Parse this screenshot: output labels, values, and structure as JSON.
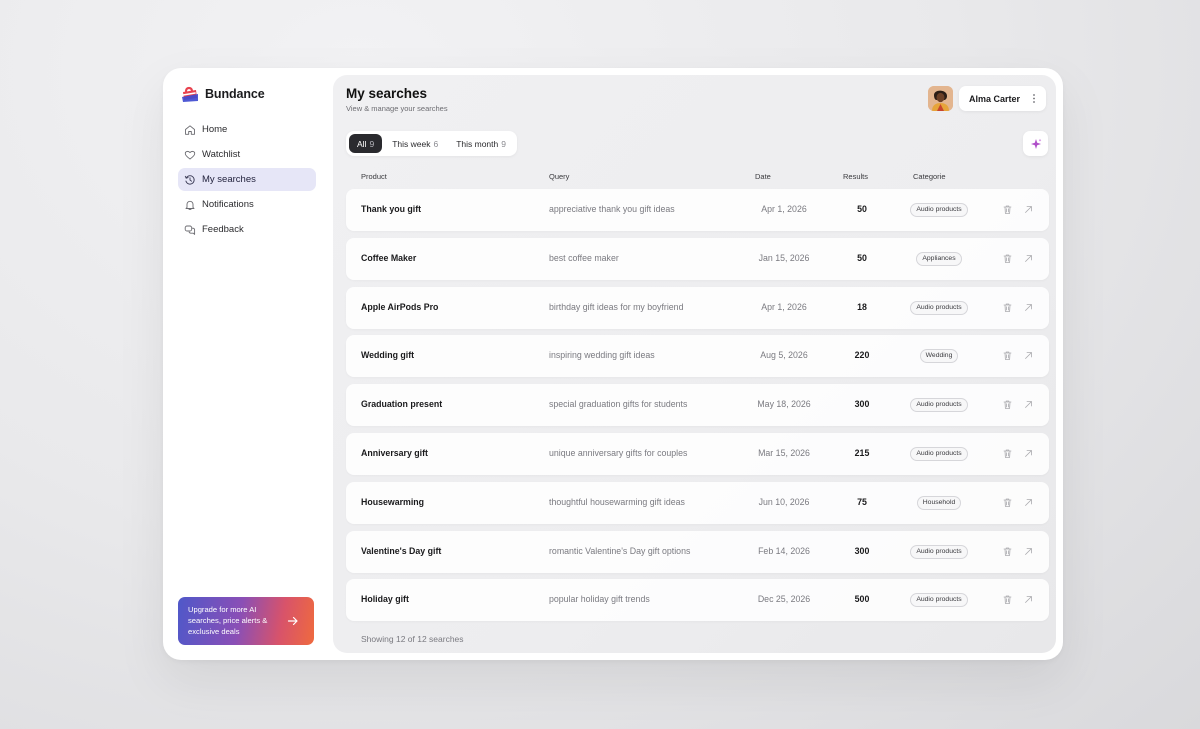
{
  "brand": {
    "name": "Bundance"
  },
  "sidebar": {
    "items": [
      {
        "label": "Home",
        "icon": "home-icon",
        "active": false
      },
      {
        "label": "Watchlist",
        "icon": "heart-icon",
        "active": false
      },
      {
        "label": "My searches",
        "icon": "history-icon",
        "active": true
      },
      {
        "label": "Notifications",
        "icon": "bell-icon",
        "active": false
      },
      {
        "label": "Feedback",
        "icon": "chat-icon",
        "active": false
      }
    ],
    "upgrade": {
      "text": "Upgrade for more AI searches, price alerts & exclusive deals",
      "icon": "arrow-right-icon"
    }
  },
  "header": {
    "title": "My searches",
    "subtitle": "View & manage your searches",
    "user": {
      "name": "Alma Carter"
    }
  },
  "tabs": [
    {
      "label": "All",
      "count": "9",
      "active": true
    },
    {
      "label": "This week",
      "count": "6",
      "active": false
    },
    {
      "label": "This month",
      "count": "9",
      "active": false
    }
  ],
  "table": {
    "columns": {
      "product": "Product",
      "query": "Query",
      "date": "Date",
      "results": "Results",
      "category": "Categorie"
    },
    "rows": [
      {
        "product": "Thank you gift",
        "query": "appreciative thank you gift ideas",
        "date": "Apr 1, 2026",
        "results": "50",
        "category": "Audio products"
      },
      {
        "product": "Coffee Maker",
        "query": "best coffee maker",
        "date": "Jan 15, 2026",
        "results": "50",
        "category": "Appliances"
      },
      {
        "product": "Apple AirPods Pro",
        "query": "birthday gift ideas for my boyfriend",
        "date": "Apr 1, 2026",
        "results": "18",
        "category": "Audio products"
      },
      {
        "product": "Wedding gift",
        "query": "inspiring wedding gift ideas",
        "date": "Aug 5, 2026",
        "results": "220",
        "category": "Wedding"
      },
      {
        "product": "Graduation present",
        "query": "special graduation gifts for students",
        "date": "May 18, 2026",
        "results": "300",
        "category": "Audio products"
      },
      {
        "product": "Anniversary gift",
        "query": "unique anniversary gifts for couples",
        "date": "Mar 15, 2026",
        "results": "215",
        "category": "Audio products"
      },
      {
        "product": "Housewarming",
        "query": "thoughtful housewarming gift ideas",
        "date": "Jun 10, 2026",
        "results": "75",
        "category": "Household"
      },
      {
        "product": "Valentine's Day gift",
        "query": "romantic Valentine's Day gift options",
        "date": "Feb 14, 2026",
        "results": "300",
        "category": "Audio products"
      },
      {
        "product": "Holiday gift",
        "query": "popular holiday gift trends",
        "date": "Dec 25, 2026",
        "results": "500",
        "category": "Audio products"
      }
    ],
    "footer": "Showing 12 of 12 searches"
  },
  "colors": {
    "accent": "#e6e6f7",
    "active_tab": "#2a2a2e",
    "brand_red": "#e8424f",
    "brand_blue": "#3f4bd0",
    "sparkle": "#b04fc9"
  }
}
